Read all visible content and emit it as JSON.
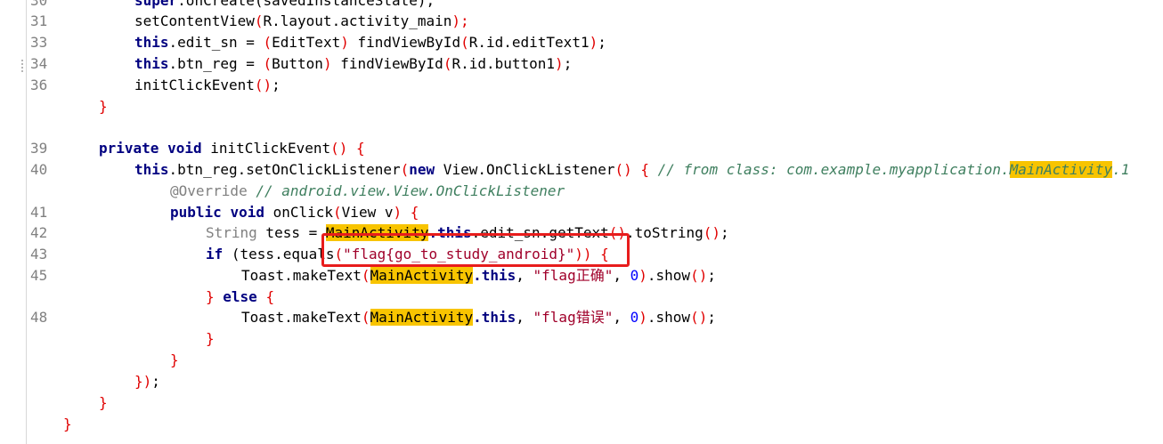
{
  "lines": {
    "l30": {
      "num": "30",
      "a": "super",
      "b": ".onCreate(savedInstanceState);"
    },
    "l31": {
      "num": "31",
      "a": "setContentView",
      "b": "(",
      "c": "R.layout.activity_main",
      "d": ");"
    },
    "l33": {
      "num": "33",
      "kw": "this",
      "a": ".edit_sn = ",
      "b": "(",
      "c": "EditText",
      "d": ")",
      "e": " findViewById",
      "f": "(",
      "g": "R.id.editText1",
      "h": ")",
      "i": ";"
    },
    "l34": {
      "num": "34",
      "kw": "this",
      "a": ".btn_reg = ",
      "b": "(",
      "c": "Button",
      "d": ")",
      "e": " findViewById",
      "f": "(",
      "g": "R.id.button1",
      "h": ")",
      "i": ";"
    },
    "l36": {
      "num": "36",
      "a": "initClickEvent",
      "b": "()",
      "c": ";"
    },
    "l37": {
      "num": "",
      "a": "}"
    },
    "l39": {
      "num": "39",
      "kw1": "private",
      "kw2": "void",
      "a": " initClickEvent",
      "b": "()",
      "c": " {"
    },
    "l40": {
      "num": "40",
      "kw": "this",
      "a": ".btn_reg.setOnClickListener",
      "b": "(",
      "kw2": "new",
      "c": " View.OnClickListener",
      "d": "()",
      "e": " { ",
      "f": "// from class: com.example.myapplication.",
      "g": "MainActivity",
      "h": ".1"
    },
    "l40b": {
      "num": "",
      "a": "@Override",
      "b": " // android.view.View.OnClickListener"
    },
    "l41": {
      "num": "41",
      "kw1": "public",
      "kw2": "void",
      "a": " onClick",
      "b": "(",
      "c": "View v",
      "d": ")",
      "e": " {"
    },
    "l42": {
      "num": "42",
      "a": "String",
      "b": " tess = ",
      "c": "MainActivity",
      "kw": ".this",
      "d": ".edit_sn.getText",
      "e": "()",
      "f": ".toString",
      "g": "()",
      "h": ";"
    },
    "l43": {
      "num": "43",
      "kw": "if",
      "a": " (",
      "b": "tess.equals",
      "c": "(",
      "d": "\"flag{go_to_study_android}\"",
      "e": "))",
      "f": " {"
    },
    "l45": {
      "num": "45",
      "a": "Toast.makeText",
      "b": "(",
      "c": "MainActivity",
      "kw": ".this",
      "d": ", ",
      "e": "\"flag正确\"",
      "f": ", ",
      "g": "0",
      "h": ")",
      "i": ".show",
      "j": "()",
      "k": ";"
    },
    "l46": {
      "num": "",
      "a": "}",
      "kw": " else",
      "b": " {"
    },
    "l48": {
      "num": "48",
      "a": "Toast.makeText",
      "b": "(",
      "c": "MainActivity",
      "kw": ".this",
      "d": ", ",
      "e": "\"flag错误\"",
      "f": ", ",
      "g": "0",
      "h": ")",
      "i": ".show",
      "j": "()",
      "k": ";"
    },
    "l49": {
      "num": "",
      "a": "}"
    },
    "l50": {
      "num": "",
      "a": "}"
    },
    "l51": {
      "num": "",
      "a": "})",
      "b": ";"
    },
    "l52": {
      "num": "",
      "a": "}"
    },
    "l53": {
      "num": "",
      "a": "}"
    }
  },
  "colors": {
    "highlight": "#f8c400",
    "annotation_box": "#e81c1c",
    "keyword": "#000080",
    "comment": "#3f7f5f"
  }
}
